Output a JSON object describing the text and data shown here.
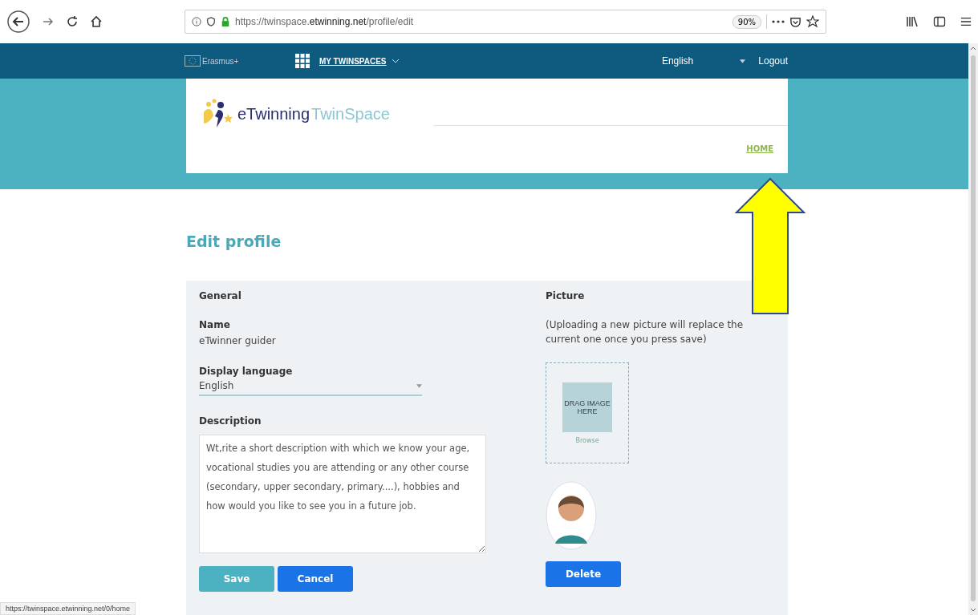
{
  "browser": {
    "url": "https://twinspace.**etwinning.net**/profile/edit",
    "zoom": "90%"
  },
  "nav": {
    "logo_text": "Erasmus+",
    "menu": "MY TWINSPACES",
    "language": "English",
    "logout": "Logout"
  },
  "header": {
    "logo_main": "eTwinning",
    "logo_sub": "TwinSpace",
    "home_link": "HOME"
  },
  "page_title": "Edit profile",
  "general": {
    "heading": "General",
    "name_label": "Name",
    "name_value": "eTwinner guider",
    "language_label": "Display language",
    "language_value": "English",
    "description_label": "Description",
    "description_value": "Wt,rite a short description with which we know your age, vocational studies you are attending or any other course (secondary, upper secondary, primary....), hobbies and how would you like to see you in a future job."
  },
  "picture": {
    "heading": "Picture",
    "note": "(Uploading a new picture will replace the current one once you press save)",
    "drop_text": "DRAG IMAGE HERE",
    "browse": "Browse",
    "delete": "Delete"
  },
  "buttons": [
    {
      "label": "Save",
      "kind": "secondary"
    },
    {
      "label": "Cancel",
      "kind": "primary"
    }
  ],
  "status_link": "https://twinspace.etwinning.net/0/home"
}
